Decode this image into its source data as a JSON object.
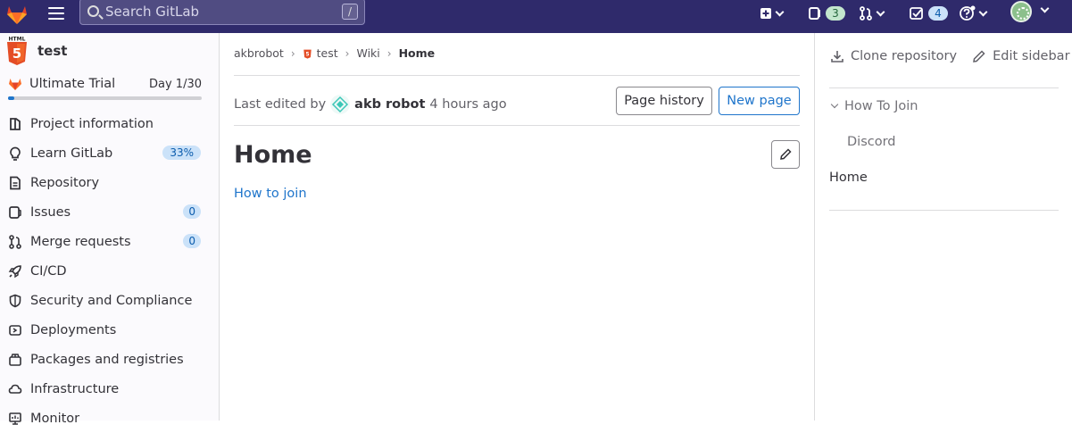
{
  "topbar": {
    "search_placeholder": "Search GitLab",
    "search_shortcut": "/",
    "merge_requests_count": "3",
    "todos_count": "4",
    "icons": [
      "gitlab-logo-icon",
      "menu-icon",
      "search-icon",
      "new-icon",
      "issues-icon",
      "merge-request-icon",
      "todo-icon",
      "help-icon",
      "avatar"
    ]
  },
  "sidebar": {
    "project_name": "test",
    "trial_label": "Ultimate Trial",
    "trial_day": "Day 1/30",
    "trial_progress": 0.033,
    "items": [
      {
        "label": "Project information",
        "icon": "project-icon"
      },
      {
        "label": "Learn GitLab",
        "icon": "bulb-icon",
        "pill": "33%"
      },
      {
        "label": "Repository",
        "icon": "doc-icon"
      },
      {
        "label": "Issues",
        "icon": "issues-icon",
        "badge": "0"
      },
      {
        "label": "Merge requests",
        "icon": "merge-request-icon",
        "badge": "0"
      },
      {
        "label": "CI/CD",
        "icon": "rocket-icon"
      },
      {
        "label": "Security and Compliance",
        "icon": "shield-icon"
      },
      {
        "label": "Deployments",
        "icon": "deployments-icon"
      },
      {
        "label": "Packages and registries",
        "icon": "package-icon"
      },
      {
        "label": "Infrastructure",
        "icon": "cloud-icon"
      },
      {
        "label": "Monitor",
        "icon": "monitor-icon"
      }
    ]
  },
  "breadcrumbs": [
    {
      "label": "akbrobot"
    },
    {
      "label": "test"
    },
    {
      "label": "Wiki"
    },
    {
      "label": "Home"
    }
  ],
  "wiki": {
    "last_edited_prefix": "Last edited by",
    "author": "akb robot",
    "time_ago": "4 hours ago",
    "page_history_label": "Page history",
    "new_page_label": "New page",
    "title": "Home",
    "content_link": "How to join"
  },
  "right_sidebar": {
    "clone_label": "Clone repository",
    "edit_sidebar_label": "Edit sidebar",
    "tree": {
      "folder": "How To Join",
      "child": "Discord",
      "page": "Home"
    }
  },
  "colors": {
    "topbar": "#2f2a6b",
    "link": "#1f75cb",
    "badge_bg": "#cbe2f9"
  }
}
